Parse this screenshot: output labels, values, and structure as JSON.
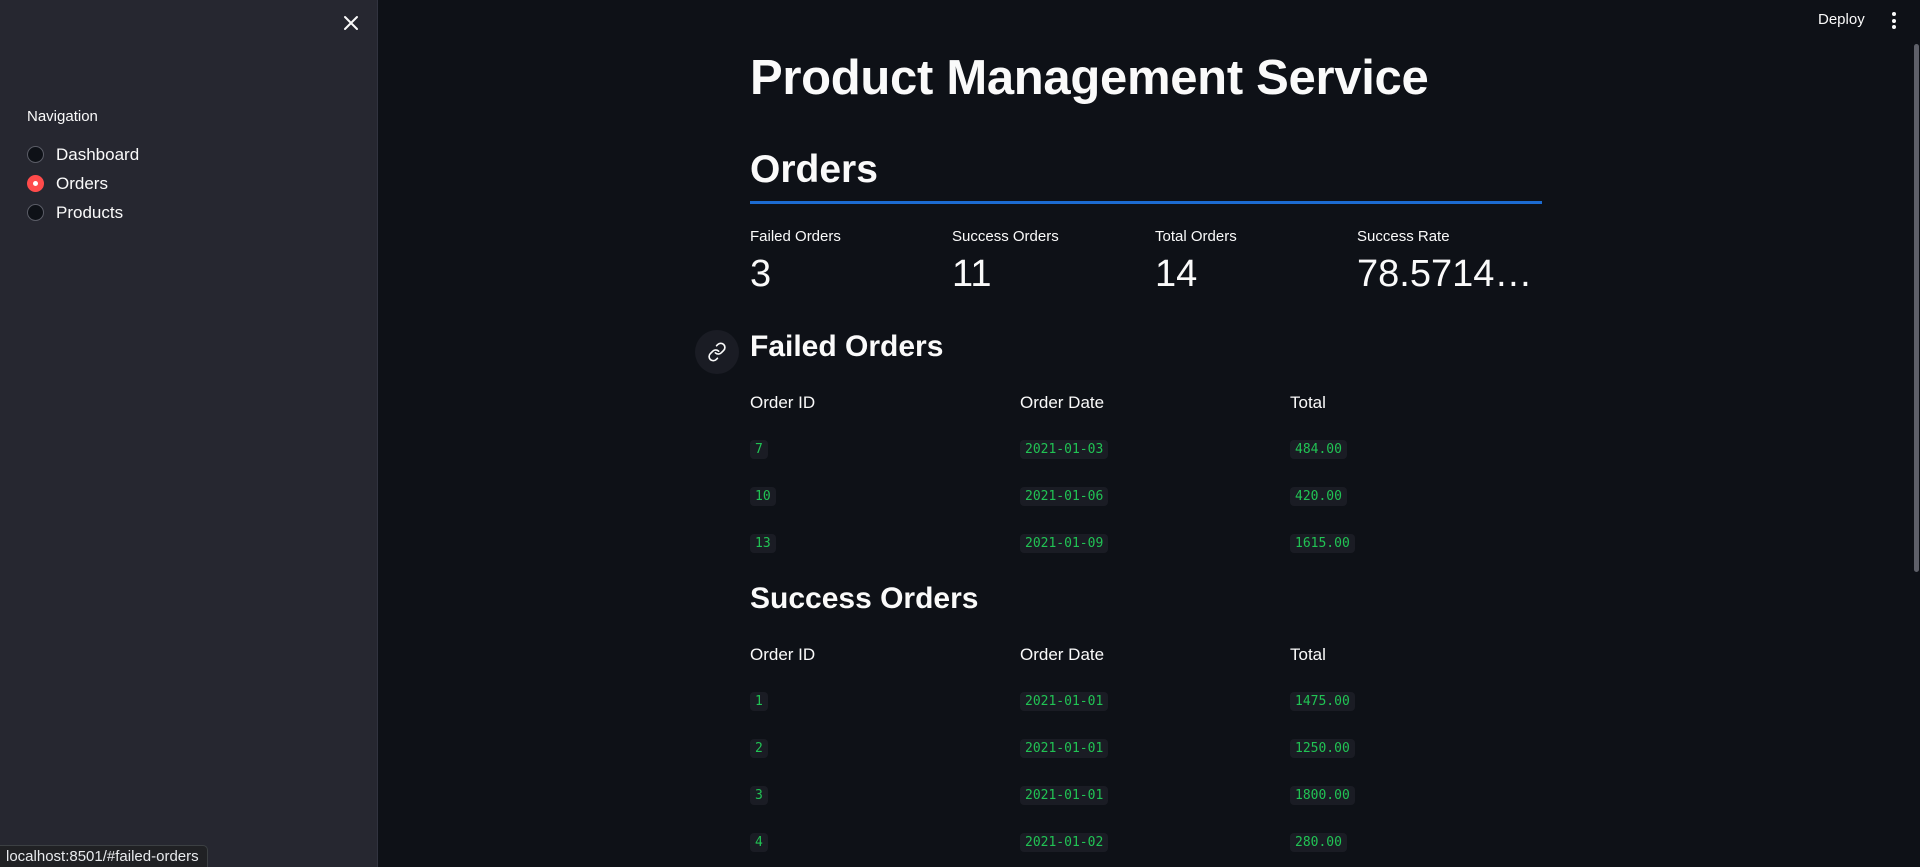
{
  "sidebar": {
    "nav_label": "Navigation",
    "items": [
      {
        "label": "Dashboard",
        "selected": false
      },
      {
        "label": "Orders",
        "selected": true
      },
      {
        "label": "Products",
        "selected": false
      }
    ]
  },
  "toolbar": {
    "deploy_label": "Deploy"
  },
  "status_url": "localhost:8501/#failed-orders",
  "main": {
    "title": "Product Management Service",
    "section": "Orders",
    "metrics": [
      {
        "label": "Failed Orders",
        "value": "3"
      },
      {
        "label": "Success Orders",
        "value": "11"
      },
      {
        "label": "Total Orders",
        "value": "14"
      },
      {
        "label": "Success Rate",
        "value": "78.5714…"
      }
    ],
    "failed": {
      "title": "Failed Orders",
      "headers": [
        "Order ID",
        "Order Date",
        "Total"
      ],
      "rows": [
        [
          "7",
          "2021-01-03",
          "484.00"
        ],
        [
          "10",
          "2021-01-06",
          "420.00"
        ],
        [
          "13",
          "2021-01-09",
          "1615.00"
        ]
      ]
    },
    "success": {
      "title": "Success Orders",
      "headers": [
        "Order ID",
        "Order Date",
        "Total"
      ],
      "rows": [
        [
          "1",
          "2021-01-01",
          "1475.00"
        ],
        [
          "2",
          "2021-01-01",
          "1250.00"
        ],
        [
          "3",
          "2021-01-01",
          "1800.00"
        ],
        [
          "4",
          "2021-01-02",
          "280.00"
        ]
      ]
    }
  },
  "colors": {
    "accent": "#ff4b4b",
    "divider": "#1c6bd1",
    "code_text": "#21c354",
    "background": "#0e1117",
    "sidebar": "#262730"
  }
}
